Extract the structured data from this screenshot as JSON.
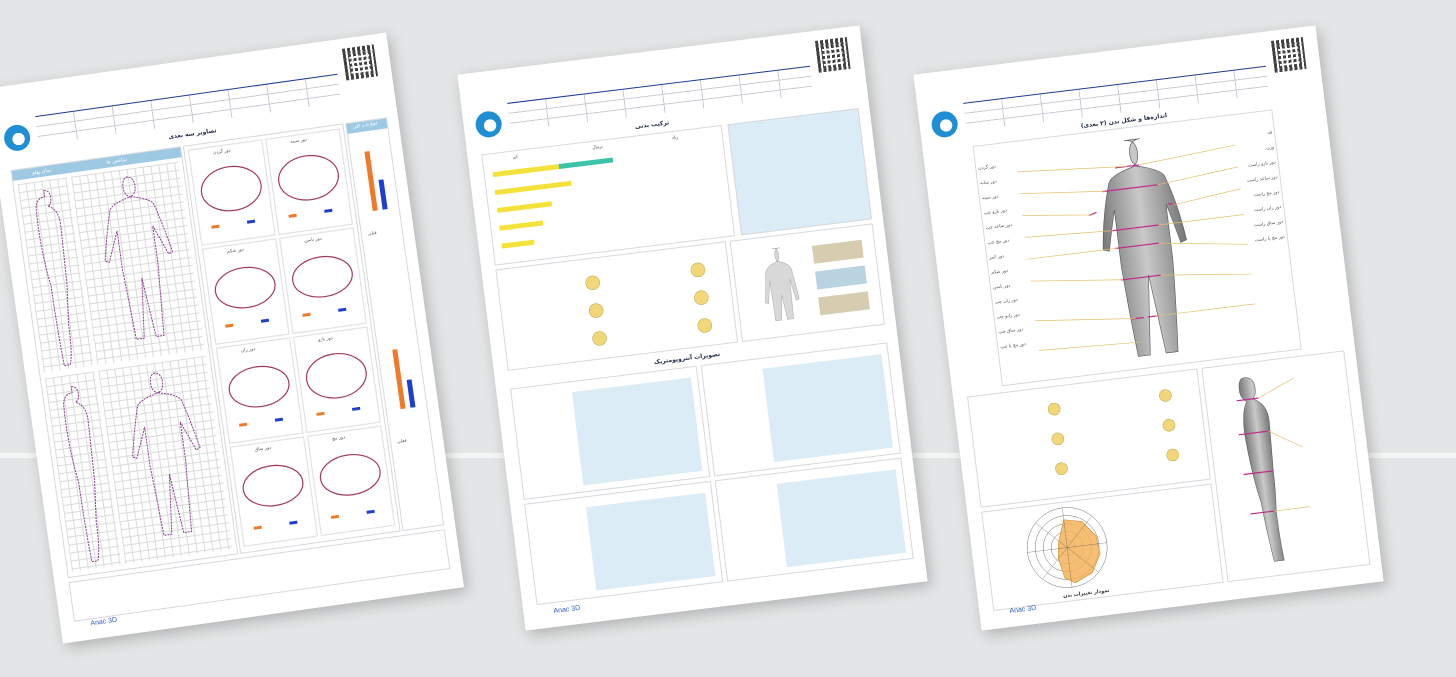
{
  "sheets": [
    {
      "title": "تصاویر سه بعدی",
      "footer_brand": "Anac 3D",
      "section_headers": [
        "اطلاعات کلی",
        "شاخص ها",
        "نمای پهلو"
      ],
      "cross_sections": [
        "دور گردن",
        "دور سینه",
        "دور شکم",
        "دور باسن",
        "دور ران",
        "دور بازو",
        "دور ساق",
        "دور مچ"
      ],
      "legend_items": [
        "قبلی",
        "فعلی"
      ]
    },
    {
      "title": "ترکیب بدنی",
      "section_title_2": "تصویرات آنتروپومتریک",
      "footer_brand": "Anac 3D",
      "bar_labels": [
        "کم",
        "نرمال",
        "زیاد"
      ],
      "bar_levels": [
        0.55,
        0.35,
        0.25,
        0.2,
        0.15
      ]
    },
    {
      "title": "اندازه‌ها و شکل بدن (۳ بعدی)",
      "section_title_2": "نمودار تغییرات",
      "footer_brand": "Anac 3D",
      "callouts_left": [
        "دور گردن",
        "دور شانه",
        "دور سینه",
        "دور بازو چپ",
        "دور ساعد چپ",
        "دور مچ چپ",
        "دور کمر",
        "دور شکم",
        "دور باسن",
        "دور ران چپ",
        "دور زانو چپ",
        "دور ساق چپ",
        "دور مچ پا چپ"
      ],
      "callouts_right": [
        "قد",
        "وزن",
        "دور بازو راست",
        "دور ساعد راست",
        "دور مچ راست",
        "دور ران راست",
        "دور ساق راست",
        "دور مچ پا راست"
      ],
      "radar_caption": "نمودار تغییرات بدن"
    }
  ]
}
